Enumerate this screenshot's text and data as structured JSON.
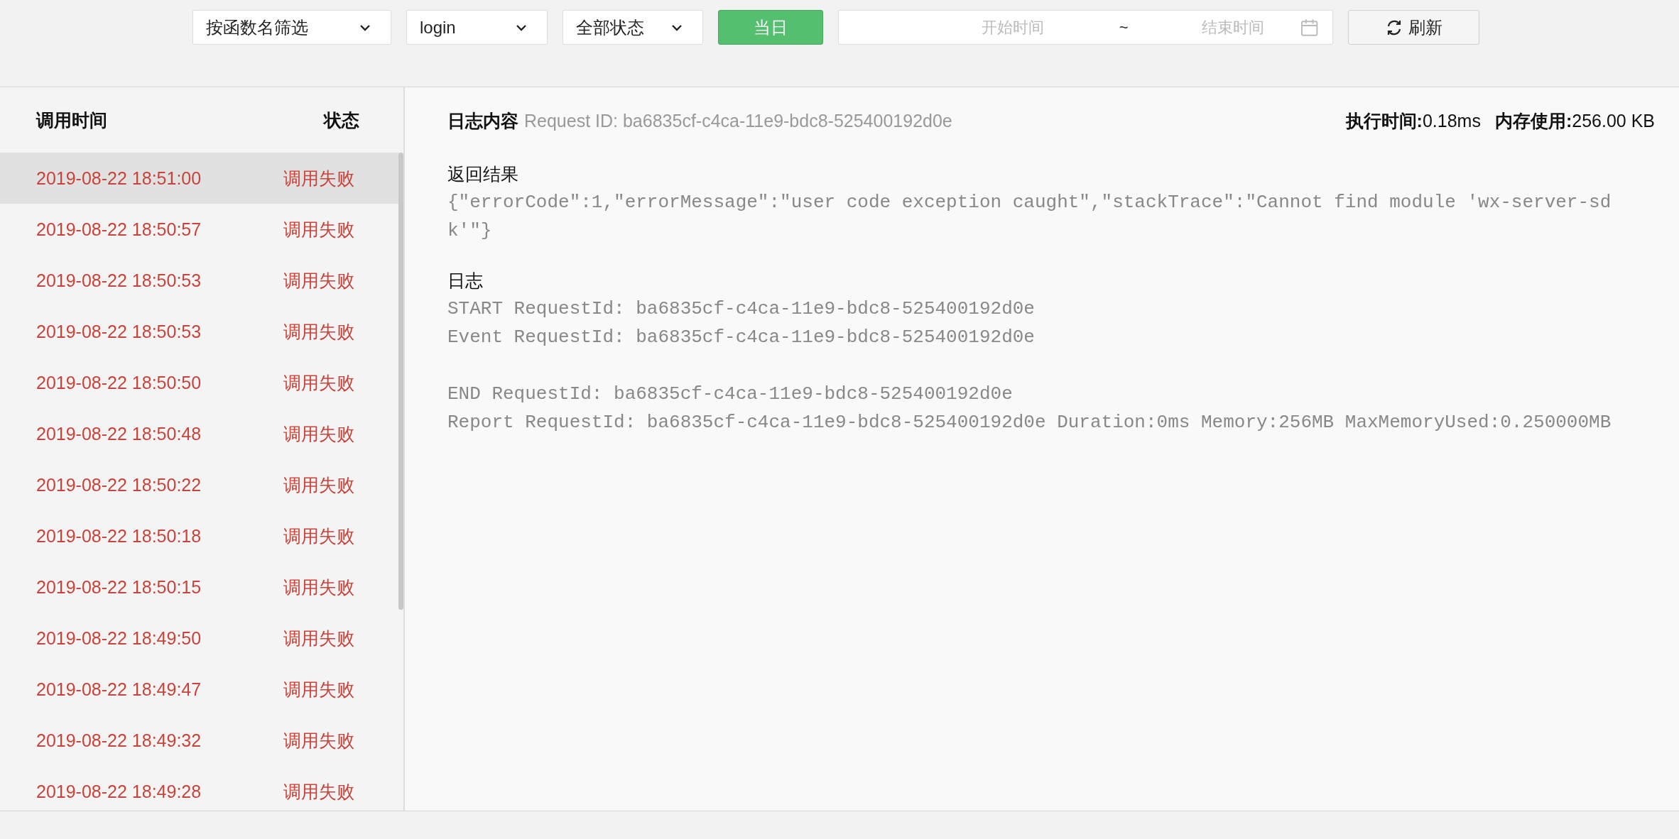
{
  "toolbar": {
    "filters": [
      {
        "value": "按函数名筛选"
      },
      {
        "value": "login"
      },
      {
        "value": "全部状态"
      }
    ],
    "today_button": {
      "label": "当日",
      "selected": true
    },
    "date_range": {
      "start_placeholder": "开始时间",
      "separator": "~",
      "end_placeholder": "结束时间"
    },
    "refresh_button": {
      "label": "刷新"
    }
  },
  "call_list": {
    "columns": [
      "调用时间",
      "状态"
    ],
    "rows": [
      {
        "time": "2019-08-22 18:51:00",
        "status": "调用失败",
        "selected": true
      },
      {
        "time": "2019-08-22 18:50:57",
        "status": "调用失败",
        "selected": false
      },
      {
        "time": "2019-08-22 18:50:53",
        "status": "调用失败",
        "selected": false
      },
      {
        "time": "2019-08-22 18:50:53",
        "status": "调用失败",
        "selected": false
      },
      {
        "time": "2019-08-22 18:50:50",
        "status": "调用失败",
        "selected": false
      },
      {
        "time": "2019-08-22 18:50:48",
        "status": "调用失败",
        "selected": false
      },
      {
        "time": "2019-08-22 18:50:22",
        "status": "调用失败",
        "selected": false
      },
      {
        "time": "2019-08-22 18:50:18",
        "status": "调用失败",
        "selected": false
      },
      {
        "time": "2019-08-22 18:50:15",
        "status": "调用失败",
        "selected": false
      },
      {
        "time": "2019-08-22 18:49:50",
        "status": "调用失败",
        "selected": false
      },
      {
        "time": "2019-08-22 18:49:47",
        "status": "调用失败",
        "selected": false
      },
      {
        "time": "2019-08-22 18:49:32",
        "status": "调用失败",
        "selected": false
      },
      {
        "time": "2019-08-22 18:49:28",
        "status": "调用失败",
        "selected": false
      }
    ]
  },
  "log_detail": {
    "title": "日志内容",
    "request_id": "Request ID: ba6835cf-c4ca-11e9-bdc8-525400192d0e",
    "stats": [
      {
        "label": "执行时间:",
        "value": "0.18ms"
      },
      {
        "label": "内存使用:",
        "value": "256.00 KB"
      }
    ],
    "result_heading": "返回结果",
    "result": "{\"errorCode\":1,\"errorMessage\":\"user code exception caught\",\"stackTrace\":\"Cannot find module 'wx-server-sdk'\"}",
    "log_heading": "日志",
    "log_groups": [
      [
        "START RequestId: ba6835cf-c4ca-11e9-bdc8-525400192d0e",
        "Event RequestId: ba6835cf-c4ca-11e9-bdc8-525400192d0e"
      ],
      [
        "END RequestId: ba6835cf-c4ca-11e9-bdc8-525400192d0e",
        "Report RequestId: ba6835cf-c4ca-11e9-bdc8-525400192d0e Duration:0ms Memory:256MB MaxMemoryUsed:0.250000MB"
      ]
    ]
  }
}
